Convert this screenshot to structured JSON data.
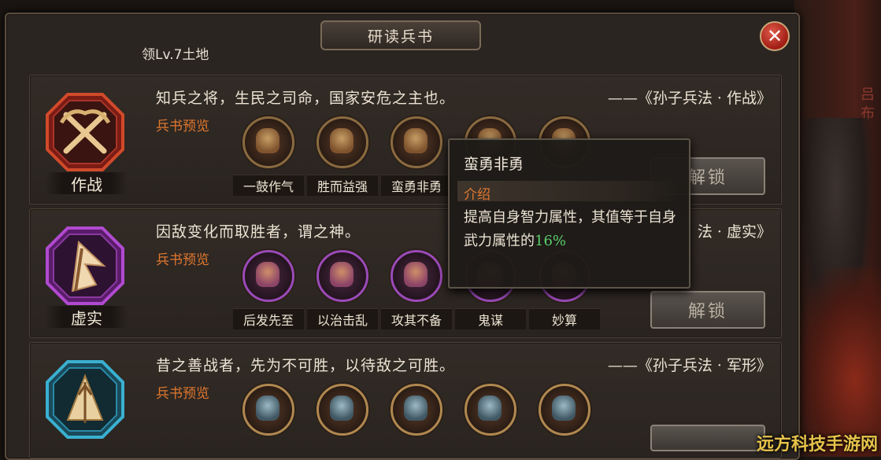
{
  "window": {
    "title": "研读兵书",
    "requirement": "领Lv.7土地"
  },
  "cards": [
    {
      "emblem_label": "作战",
      "quote": "知兵之将，生民之司命，国家安危之主也。",
      "source": "——《孙子兵法 · 作战》",
      "preview_label": "兵书预览",
      "skills": [
        "一鼓作气",
        "胜而益强",
        "蛮勇非勇",
        "",
        ""
      ],
      "unlock_label": "解锁"
    },
    {
      "emblem_label": "虚实",
      "quote": "因敌变化而取胜者，谓之神。",
      "source": "法 · 虚实》",
      "preview_label": "兵书预览",
      "skills": [
        "后发先至",
        "以治击乱",
        "攻其不备",
        "鬼谋",
        "妙算"
      ],
      "unlock_label": "解锁"
    },
    {
      "emblem_label": "",
      "quote": "昔之善战者，先为不可胜，以待敌之可胜。",
      "source": "——《孙子兵法 · 军形》",
      "preview_label": "兵书预览",
      "skills": [
        "",
        "",
        "",
        "",
        ""
      ],
      "unlock_label": ""
    }
  ],
  "tooltip": {
    "title": "蛮勇非勇",
    "section": "介绍",
    "body_prefix": "提高自身智力属性，其值等于自身武力属性的",
    "body_pct": "16%"
  },
  "background": {
    "side_text": "吕布"
  },
  "watermark": "远方科技手游网",
  "colors": {
    "accent_orange": "#e0782e",
    "accent_green": "#5bd06a",
    "close_red": "#a01c14"
  }
}
